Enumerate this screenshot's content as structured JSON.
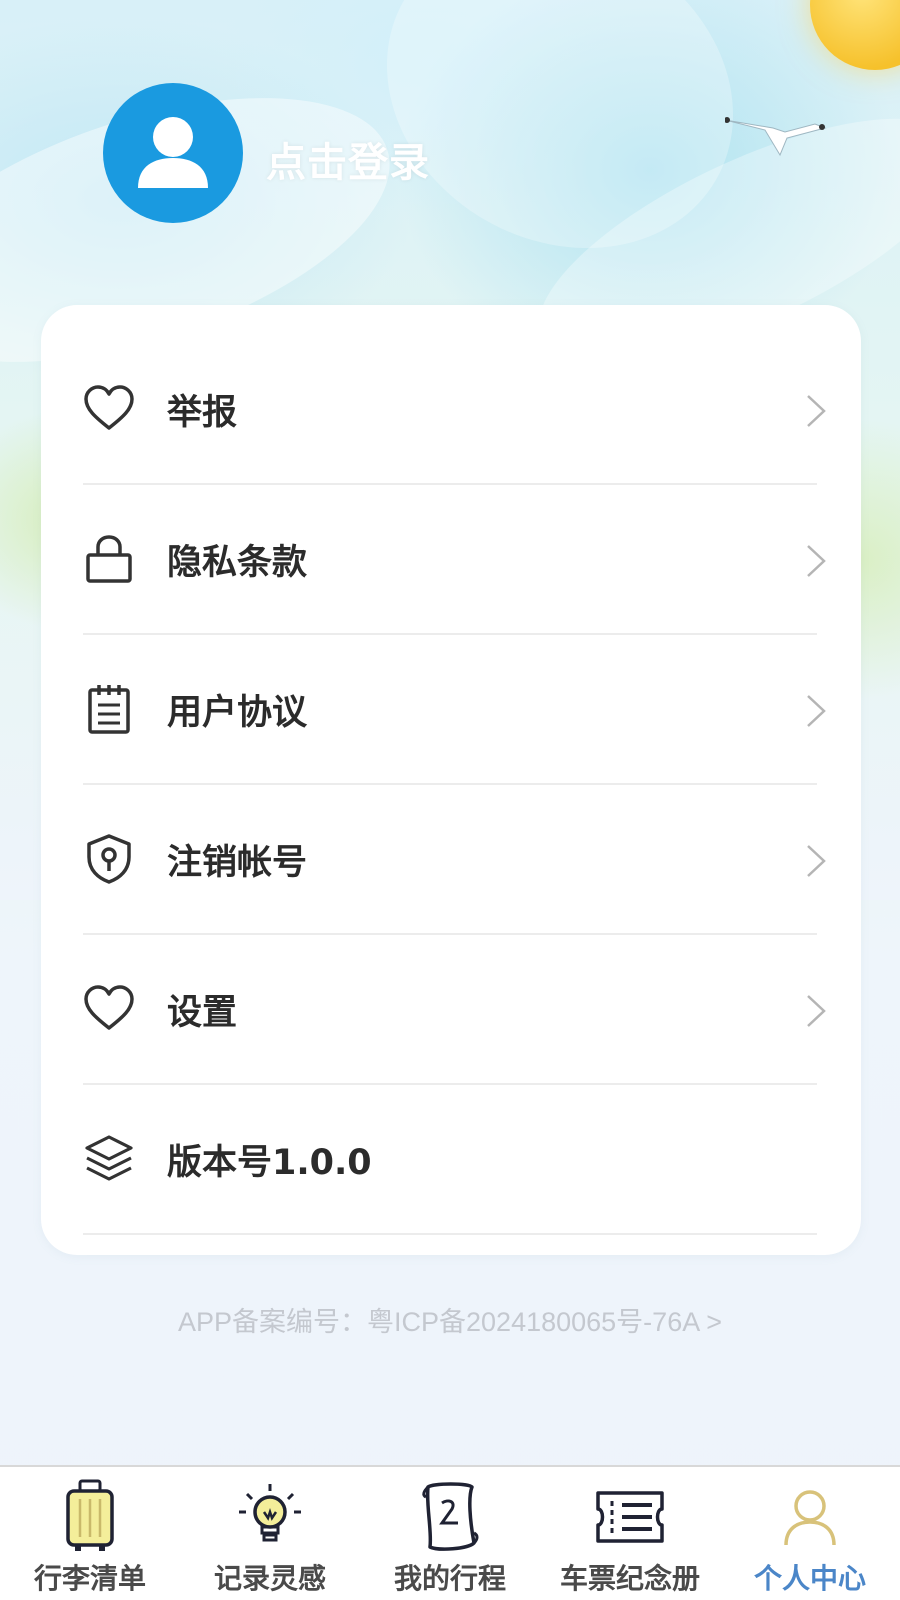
{
  "header": {
    "login_label": "点击登录"
  },
  "menu": [
    {
      "label": "举报",
      "icon": "heart-icon",
      "chevron": true
    },
    {
      "label": "隐私条款",
      "icon": "lock-icon",
      "chevron": true
    },
    {
      "label": "用户协议",
      "icon": "notepad-icon",
      "chevron": true
    },
    {
      "label": "注销帐号",
      "icon": "shield-keyhole-icon",
      "chevron": true
    },
    {
      "label": "设置",
      "icon": "heart-icon",
      "chevron": true
    },
    {
      "label": "版本号1.0.0",
      "icon": "layers-icon",
      "chevron": false
    }
  ],
  "icp": {
    "text": "APP备案编号：粤ICP备2024180065号-76A >"
  },
  "tabs": [
    {
      "label": "行李清单",
      "icon": "suitcase-icon",
      "active": false
    },
    {
      "label": "记录灵感",
      "icon": "lightbulb-icon",
      "active": false
    },
    {
      "label": "我的行程",
      "icon": "scroll-icon",
      "active": false
    },
    {
      "label": "车票纪念册",
      "icon": "ticket-icon",
      "active": false
    },
    {
      "label": "个人中心",
      "icon": "person-icon",
      "active": true
    }
  ],
  "colors": {
    "avatar_bg": "#1a9ae0",
    "active_tab": "#4b86c8",
    "menu_text": "#2b2b2b",
    "icp_text": "#c4c8cf"
  }
}
